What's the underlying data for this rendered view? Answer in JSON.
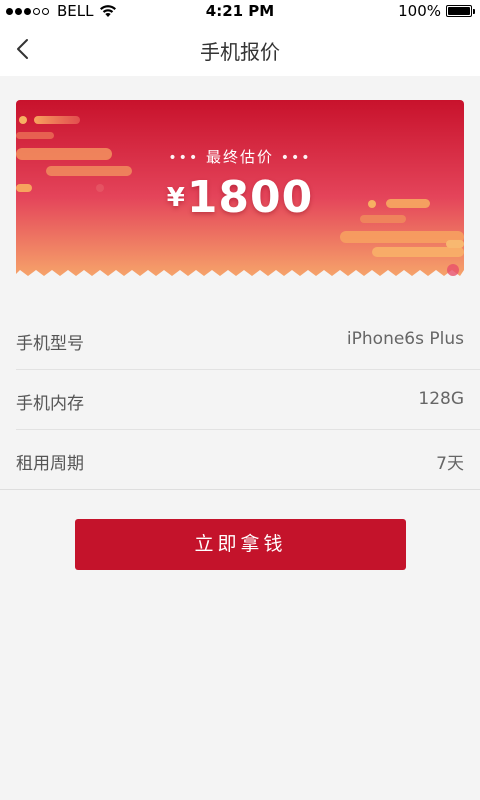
{
  "status_bar": {
    "carrier": "BELL",
    "time": "4:21 PM",
    "battery": "100%"
  },
  "nav": {
    "title": "手机报价",
    "back_icon": "chevron-left-icon"
  },
  "price_card": {
    "label": "最终估价",
    "currency": "¥",
    "amount": "1800",
    "colors": {
      "top": "#c8122c",
      "middle": "#e4445a",
      "bottom": "#f6a36a"
    }
  },
  "details": [
    {
      "label": "手机型号",
      "value": "iPhone6s Plus"
    },
    {
      "label": "手机内存",
      "value": "128G"
    },
    {
      "label": "租用周期",
      "value": "7天"
    }
  ],
  "action": {
    "label": "立即拿钱",
    "color": "#c4132b"
  }
}
